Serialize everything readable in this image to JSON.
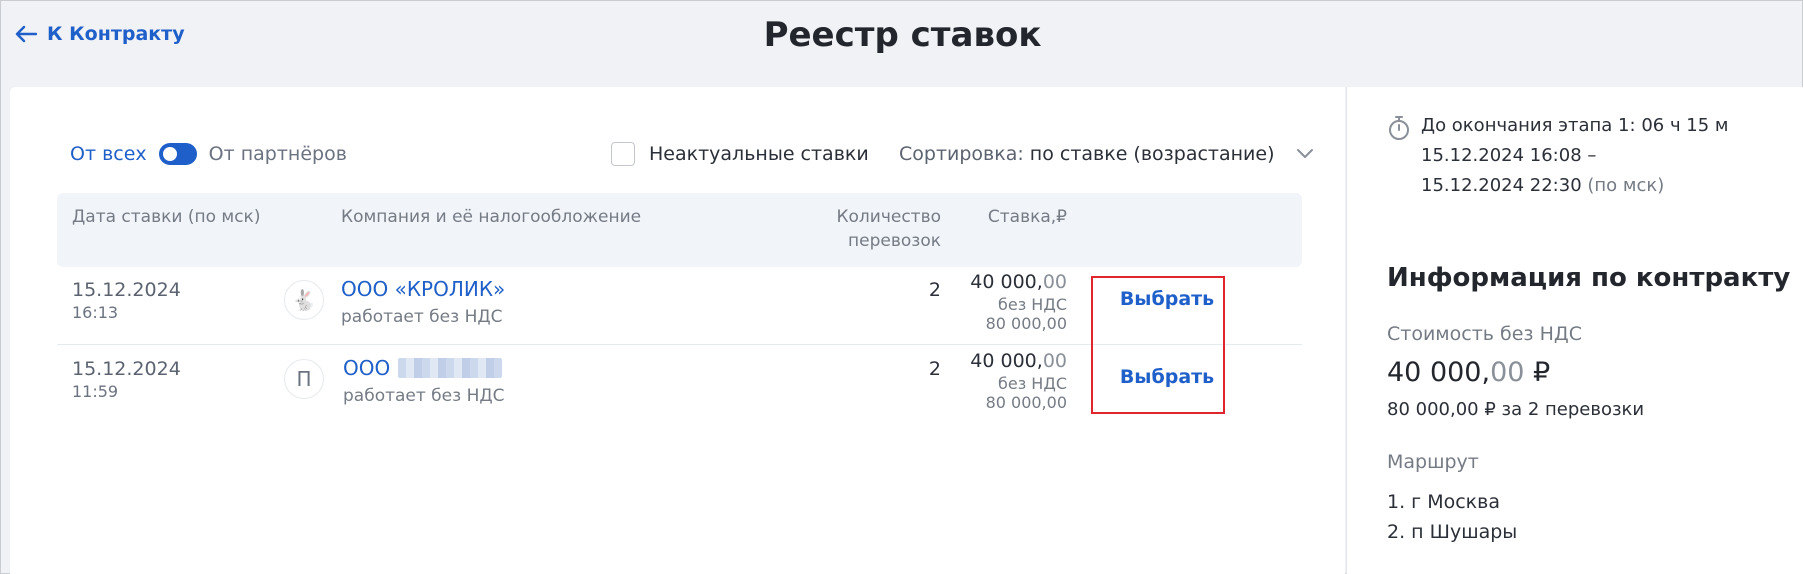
{
  "header": {
    "back_label": "К Контракту",
    "title": "Реестр ставок"
  },
  "filters": {
    "toggle_left": "От всех",
    "toggle_right": "От партнёров",
    "toggle_on": true,
    "outdated_label": "Неактуальные ставки",
    "outdated_checked": false,
    "sort_label": "Сортировка:",
    "sort_value": "по ставке (возрастание)"
  },
  "table": {
    "columns": {
      "date": "Дата ставки (по мск)",
      "company": "Компания и её налогообложение",
      "count_line1": "Количество",
      "count_line2": "перевозок",
      "rate": "Ставка,₽"
    },
    "rows": [
      {
        "date": "15.12.2024",
        "time": "16:13",
        "avatar": "🐇",
        "company": "ООО «КРОЛИК»",
        "tax": "работает без НДС",
        "count": "2",
        "rate_whole": "40 000,",
        "rate_cents": "00",
        "rate_tax": "без НДС",
        "rate_total": "80 000,00",
        "action": "Выбрать"
      },
      {
        "date": "15.12.2024",
        "time": "11:59",
        "avatar": "П",
        "company": "ООО",
        "tax": "работает без НДС",
        "count": "2",
        "rate_whole": "40 000,",
        "rate_cents": "00",
        "rate_tax": "без НДС",
        "rate_total": "80 000,00",
        "action": "Выбрать"
      }
    ]
  },
  "side": {
    "timer_prefix": "До окончания этапа 1:",
    "timer_value": "06 ч 15 м",
    "period_start": "15.12.2024 16:08 –",
    "period_end": "15.12.2024 22:30",
    "period_tz": "(по мск)",
    "info_title": "Информация по контракту",
    "cost_label": "Стоимость без НДС",
    "cost_whole": "40 000,",
    "cost_cents": "00",
    "cost_currency": " ₽",
    "cost_sub": "80 000,00 ₽ за 2 перевозки",
    "route_label": "Маршрут",
    "route": [
      "1. г Москва",
      "2. п Шушары"
    ]
  },
  "colors": {
    "accent": "#1f5fc9",
    "highlight": "#e0252c",
    "table_head_bg": "#f1f4f8"
  }
}
